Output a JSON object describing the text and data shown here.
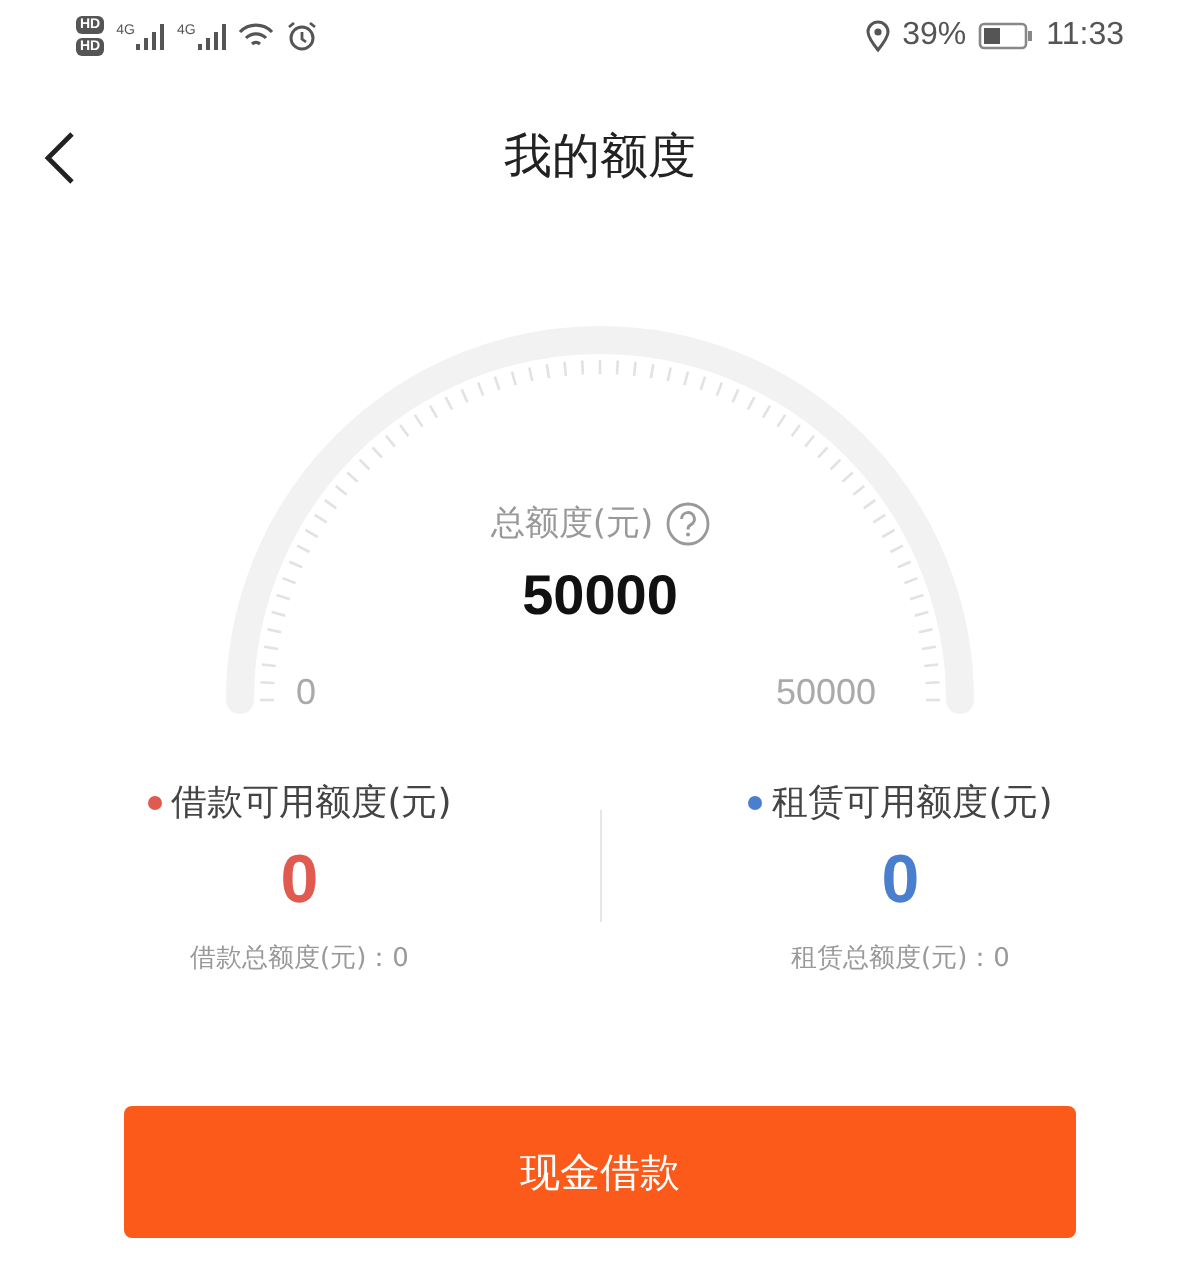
{
  "status_bar": {
    "sim_badges": [
      "HD",
      "HD"
    ],
    "networks": [
      "4G",
      "4G"
    ],
    "battery_text": "39%",
    "time": "11:33"
  },
  "header": {
    "title": "我的额度"
  },
  "gauge": {
    "label": "总额度(元)",
    "amount": "50000",
    "min_label": "0",
    "max_label": "50000"
  },
  "quotas": [
    {
      "label": "借款可用额度(元)",
      "color": "#e05a50",
      "amount": "0",
      "total": "借款总额度(元)：0"
    },
    {
      "label": "租赁可用额度(元)",
      "color": "#4a7fd0",
      "amount": "0",
      "total": "租赁总额度(元)：0"
    }
  ],
  "action": {
    "label": "现金借款"
  }
}
